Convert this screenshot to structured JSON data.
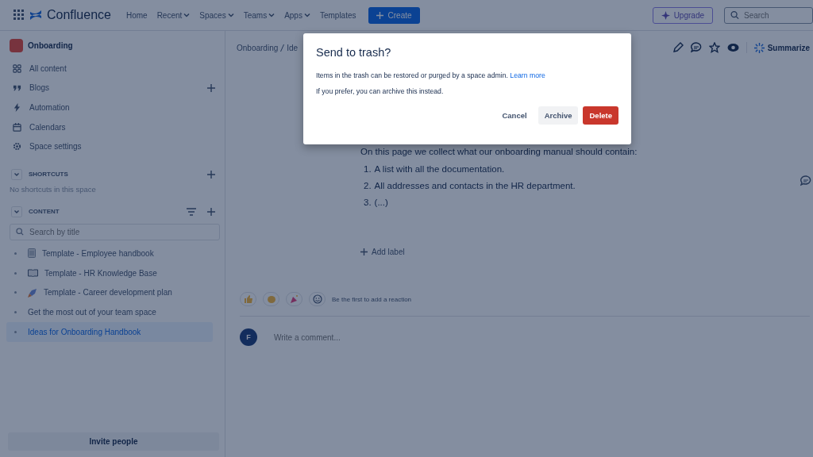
{
  "top_nav": {
    "product": "Confluence",
    "items": [
      {
        "label": "Home",
        "dropdown": false
      },
      {
        "label": "Recent",
        "dropdown": true
      },
      {
        "label": "Spaces",
        "dropdown": true
      },
      {
        "label": "Teams",
        "dropdown": true
      },
      {
        "label": "Apps",
        "dropdown": true
      },
      {
        "label": "Templates",
        "dropdown": false
      }
    ],
    "create_button": "Create",
    "upgrade_button": "Upgrade",
    "search": {
      "placeholder": "Search"
    }
  },
  "sidebar": {
    "space_name": "Onboarding",
    "items": [
      {
        "label": "All content",
        "can_add": false
      },
      {
        "label": "Blogs",
        "can_add": true
      },
      {
        "label": "Automation",
        "can_add": false
      },
      {
        "label": "Calendars",
        "can_add": false
      },
      {
        "label": "Space settings",
        "can_add": false
      }
    ],
    "shortcuts": {
      "title": "SHORTCUTS",
      "empty_text": "No shortcuts in this space",
      "expanded": true
    },
    "content": {
      "title": "CONTENT",
      "expanded": true,
      "search_placeholder": "Search by title",
      "pages": [
        {
          "title": "Template - Employee handbook",
          "selected": false
        },
        {
          "title": "Template - HR Knowledge Base",
          "selected": false
        },
        {
          "title": "Template - Career development plan",
          "selected": false
        },
        {
          "title": "Get the most out of your team space",
          "selected": false
        },
        {
          "title": "Ideas for Onboarding Handbook",
          "selected": true
        }
      ]
    },
    "invite_button": "Invite people"
  },
  "breadcrumb": [
    "Onboarding",
    "Ide"
  ],
  "page_actions": {
    "summarize": "Summarize"
  },
  "page": {
    "intro": "On this page we collect what our onboarding manual should contain:",
    "list": [
      {
        "number": "1.",
        "text": "A list with all the documentation."
      },
      {
        "number": "2.",
        "text": "All addresses and contacts in the HR department."
      },
      {
        "number": "3.",
        "text": "(...)"
      }
    ],
    "add_label": "Add label"
  },
  "reactions": {
    "prompt": "Be the first to add a reaction"
  },
  "comment": {
    "avatar_initial": "F",
    "placeholder": "Write a comment..."
  },
  "dialog": {
    "title": "Send to trash?",
    "message": "Items in the trash can be restored or purged by a space admin.",
    "link": "Learn more",
    "note": "If you prefer, you can archive this instead.",
    "buttons": [
      {
        "label": "Cancel",
        "kind": "subtle"
      },
      {
        "label": "Archive",
        "kind": "default"
      },
      {
        "label": "Delete",
        "kind": "danger"
      }
    ]
  }
}
